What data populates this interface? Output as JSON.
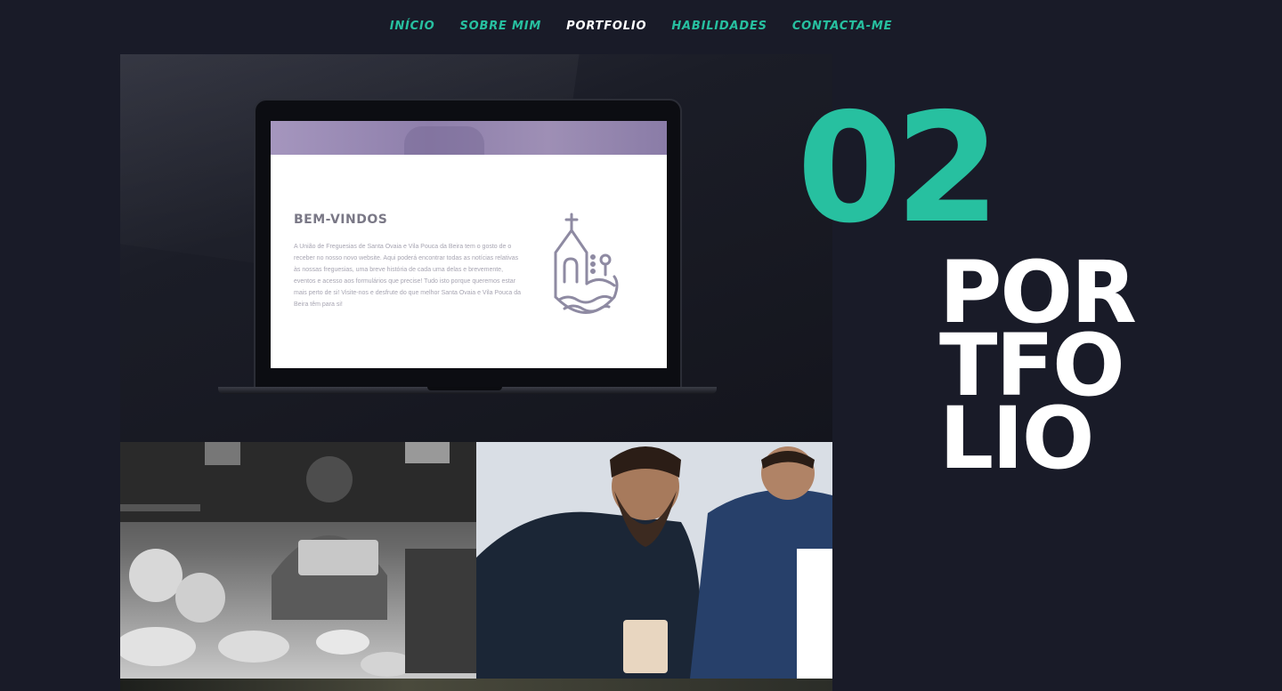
{
  "nav": {
    "items": [
      {
        "label": "INÍCIO",
        "active": false
      },
      {
        "label": "SOBRE MIM",
        "active": false
      },
      {
        "label": "PORTFOLIO",
        "active": true
      },
      {
        "label": "HABILIDADES",
        "active": false
      },
      {
        "label": "CONTACTA-ME",
        "active": false
      }
    ]
  },
  "section": {
    "number": "02",
    "title_lines": [
      "POR",
      "TFO",
      "LIO"
    ]
  },
  "project_mockup": {
    "heading": "BEM-VINDOS",
    "body": "A União de Freguesias de Santa Ovaia e Vila Pouca da Beira tem o gosto de o receber no nosso novo website. Aqui poderá encontrar todas as notícias relativas às nossas freguesias, uma breve história de cada uma delas e brevemente, eventos e acesso aos formulários que precise! Tudo isto porque queremos estar mais perto de si! Visite-nos e desfrute do que melhor Santa Ovaia e Vila Pouca da Beira têm para si!"
  },
  "colors": {
    "accent": "#27c0a0",
    "background": "#191b28",
    "text": "#ffffff"
  },
  "icons": {
    "screen_logo": "church-village-icon"
  }
}
